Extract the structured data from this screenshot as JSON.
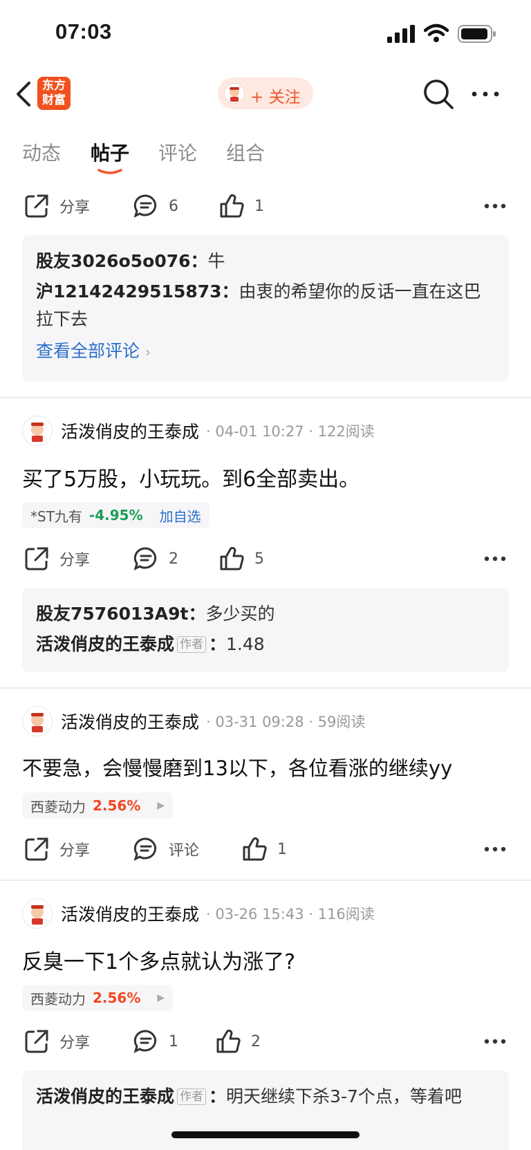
{
  "status": {
    "time": "07:03"
  },
  "nav": {
    "logo_line1": "东方",
    "logo_line2": "财富",
    "follow_label": "+ 关注"
  },
  "tabs": [
    "动态",
    "帖子",
    "评论",
    "组合"
  ],
  "share_label": "分享",
  "comment_label": "评论",
  "author_tag": "作者",
  "view_all": "查看全部评论",
  "top_actions": {
    "comments": "6",
    "likes": "1"
  },
  "top_comments": [
    {
      "user": "股友3026o5o076",
      "text": "牛"
    },
    {
      "user": "沪12142429515873",
      "text": "由衷的希望你的反话一直在这巴拉下去"
    }
  ],
  "posts": [
    {
      "author": "活泼俏皮的王泰成",
      "meta": "· 04-01 10:27 · 122阅读",
      "text": "买了5万股，小玩玩。到6全部卖出。",
      "stock": {
        "name": "*ST九有",
        "change": "-4.95%",
        "add": "加自选"
      },
      "comments": "2",
      "likes": "5",
      "replies": [
        {
          "user": "股友7576013A9t",
          "text": "多少买的"
        },
        {
          "user": "活泼俏皮的王泰成",
          "text": "1.48"
        }
      ]
    },
    {
      "author": "活泼俏皮的王泰成",
      "meta": "· 03-31 09:28 · 59阅读",
      "text": "不要急，会慢慢磨到13以下，各位看涨的继续yy",
      "stock": {
        "name": "西菱动力",
        "change": "2.56%"
      },
      "likes": "1"
    },
    {
      "author": "活泼俏皮的王泰成",
      "meta": "· 03-26 15:43 · 116阅读",
      "text": "反臭一下1个多点就认为涨了?",
      "stock": {
        "name": "西菱动力",
        "change": "2.56%"
      },
      "comments": "1",
      "likes": "2",
      "replies": [
        {
          "user": "活泼俏皮的王泰成",
          "text": "明天继续下杀3-7个点，等着吧"
        }
      ]
    }
  ]
}
